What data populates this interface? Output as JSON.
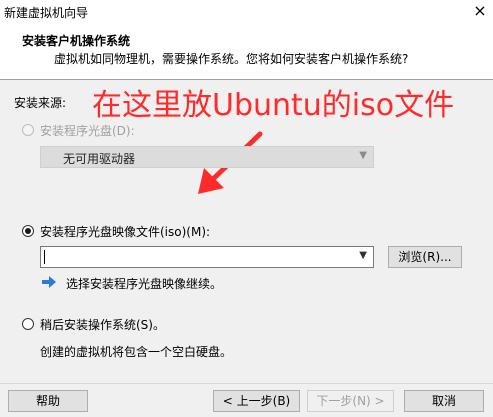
{
  "window": {
    "title": "新建虚拟机向导",
    "close_glyph": "×"
  },
  "header": {
    "title": "安装客户机操作系统",
    "description": "虚拟机如同物理机，需要操作系统。您将如何安装客户机操作系统?"
  },
  "annotation": {
    "text": "在这里放Ubuntu的iso文件",
    "color": "#ff2b2b"
  },
  "section": {
    "label": "安装来源:"
  },
  "options": {
    "disc": {
      "label": "安装程序光盘(D):",
      "selected": false,
      "enabled": false
    },
    "disc_drive": {
      "value": "无可用驱动器"
    },
    "iso": {
      "label": "安装程序光盘映像文件(iso)(M):",
      "selected": true,
      "enabled": true
    },
    "iso_path": {
      "value": ""
    },
    "browse_label": "浏览(R)...",
    "iso_hint": "选择安装程序光盘映像继续。",
    "later": {
      "label": "稍后安装操作系统(S)。",
      "selected": false,
      "enabled": true
    },
    "later_hint": "创建的虚拟机将包含一个空白硬盘。"
  },
  "footer": {
    "help": "帮助",
    "back": "< 上一步(B)",
    "next": "下一步(N) >",
    "cancel": "取消"
  }
}
